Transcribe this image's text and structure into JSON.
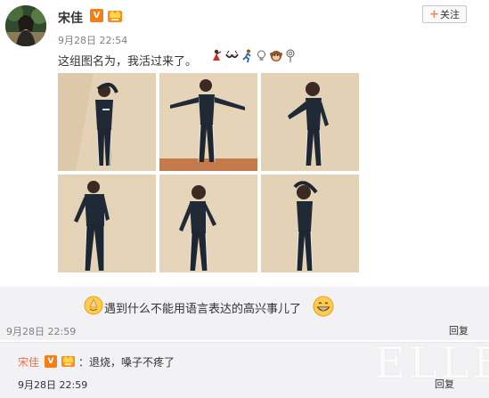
{
  "post": {
    "username": "宋佳",
    "verified_badge": "V",
    "timestamp": "9月28日 22:54",
    "follow_label": "关注",
    "text": "这组图名为，我活过来了。",
    "emojis": [
      "dancer-icon",
      "bra-icon",
      "running-icon",
      "bulb-icon",
      "monkey-icon",
      "lollipop-icon"
    ]
  },
  "photos": [
    {
      "name": "photo-1"
    },
    {
      "name": "photo-2"
    },
    {
      "name": "photo-3"
    },
    {
      "name": "photo-4"
    },
    {
      "name": "photo-5"
    },
    {
      "name": "photo-6"
    }
  ],
  "comment": {
    "text": "遇到什么不能用语言表达的高兴事儿了",
    "time": "9月28日 22:59",
    "reply_label": "回复"
  },
  "reply": {
    "username": "宋佳",
    "verified_badge": "V",
    "text": "：退烧，嗓子不疼了",
    "time": "9月28日 22:59",
    "reply_label": "回复"
  },
  "watermark": "ELLE",
  "colors": {
    "accent_orange": "#eb7350",
    "badge_orange": "#f57e15",
    "panel_bg": "#f2f2f5",
    "meta_gray": "#808080"
  }
}
